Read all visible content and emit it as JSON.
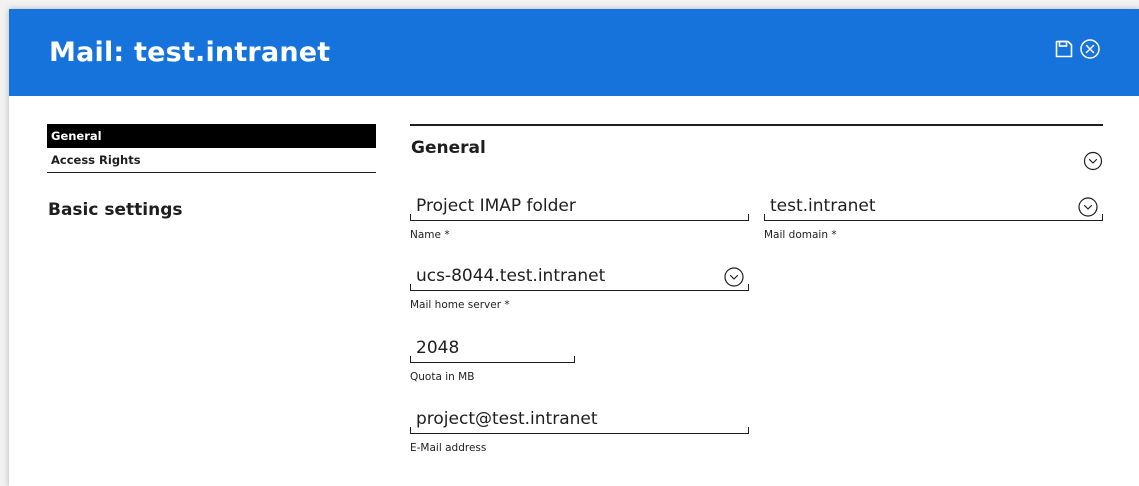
{
  "header": {
    "title": "Mail: test.intranet",
    "background": "#1673dc",
    "icons": [
      "save-icon",
      "close-circle-icon"
    ]
  },
  "nav": {
    "items": [
      {
        "label": "General",
        "active": true
      },
      {
        "label": "Access Rights",
        "active": false
      }
    ],
    "section_label": "Basic settings"
  },
  "form": {
    "title": "General",
    "fields": {
      "name": {
        "value": "Project IMAP folder",
        "label": "Name *"
      },
      "mail_domain": {
        "value": "test.intranet",
        "label": "Mail domain *"
      },
      "home_server": {
        "value": "ucs-8044.test.intranet",
        "label": "Mail home server *"
      },
      "quota": {
        "value": "2048",
        "label": "Quota in MB"
      },
      "email": {
        "value": "project@test.intranet",
        "label": "E-Mail address"
      }
    }
  }
}
